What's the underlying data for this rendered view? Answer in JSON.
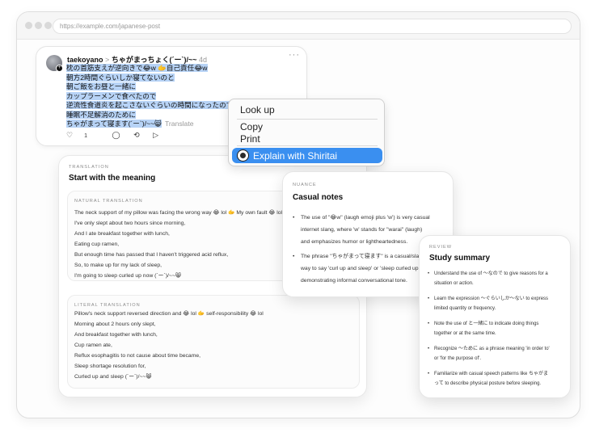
{
  "browser": {
    "url": "https://example.com/japanese-post"
  },
  "post": {
    "username": "taekoyano",
    "separator": ">",
    "display_name": "ちゃがまっちょく(´ー`)/~~",
    "time": "4d",
    "more": "···",
    "lines": [
      "枕の首筋支えが逆向きで😂w 🫱自己責任😂w",
      "朝方2時間ぐらいしか寝てないのと",
      "朝ご飯をお昼と一緒に",
      "カップラーメンで食べたので",
      "逆流性食道炎を起こさないぐらいの時間になったので",
      "睡眠不足解消のために",
      "ちゃがまって寝ます(´ー`)/~~😸"
    ],
    "translate_label": "Translate",
    "actions": {
      "likes_icon": "heart-icon",
      "like_count": "1",
      "reply_icon": "comment-icon",
      "repost_icon": "repost-icon",
      "share_icon": "send-icon"
    }
  },
  "context_menu": {
    "items": [
      "Look up",
      "Copy",
      "Print"
    ],
    "active_item": "Explain with Shiritai",
    "active_icon": "shiritai-logo-icon"
  },
  "translation": {
    "kicker": "TRANSLATION",
    "title": "Start with the meaning",
    "natural": {
      "label": "NATURAL TRANSLATION",
      "lines": [
        "The neck support of my pillow was facing the wrong way 😂 lol 🫱 My own fault 😂 lol",
        "I've only slept about two hours since morning,",
        "And I ate breakfast together with lunch,",
        "Eating cup ramen,",
        "But enough time has passed that I haven't triggered acid reflux,",
        "So, to make up for my lack of sleep,",
        "I'm going to sleep curled up now (´ー`)/~~😸"
      ]
    },
    "literal": {
      "label": "LITERAL TRANSLATION",
      "lines": [
        "Pillow's neck support reversed direction and 😂 lol 🫱 self-responsibility 😂 lol",
        "Morning about 2 hours only slept,",
        "And breakfast together with lunch,",
        "Cup ramen ate,",
        "Reflux esophagitis to not cause about time became,",
        "Sleep shortage resolution for,",
        "Curled up and sleep (´ー`)/~~😸"
      ]
    }
  },
  "nuance": {
    "kicker": "NUANCE",
    "title": "Casual notes",
    "items": [
      [
        "The use of \"😂w\" (laugh emoji plus 'w') is very casual",
        "internet slang, where 'w' stands for \"warai\" (laugh)",
        "and emphasizes humor or lightheartedness."
      ],
      [
        "The phrase \"ちゃがまって寝ます\" is a casual/slangy",
        "way to say 'curl up and sleep' or 'sleep curled up',",
        "demonstrating informal conversational tone."
      ]
    ]
  },
  "study": {
    "kicker": "REVIEW",
    "title": "Study summary",
    "items": [
      [
        "Understand the use of ～なので to give reasons for a",
        "situation or action."
      ],
      [
        "Learn the expression ～ぐらいしか～ない to express",
        "limited quantity or frequency."
      ],
      [
        "Note the use of と一緒に to indicate doing things",
        "together or at the same time."
      ],
      [
        "Recognize ～ために as a phrase meaning 'in order to'",
        "or 'for the purpose of'."
      ],
      [
        "Familiarize with casual speech patterns like ちゃがま",
        "って to describe physical posture before sleeping."
      ]
    ]
  }
}
